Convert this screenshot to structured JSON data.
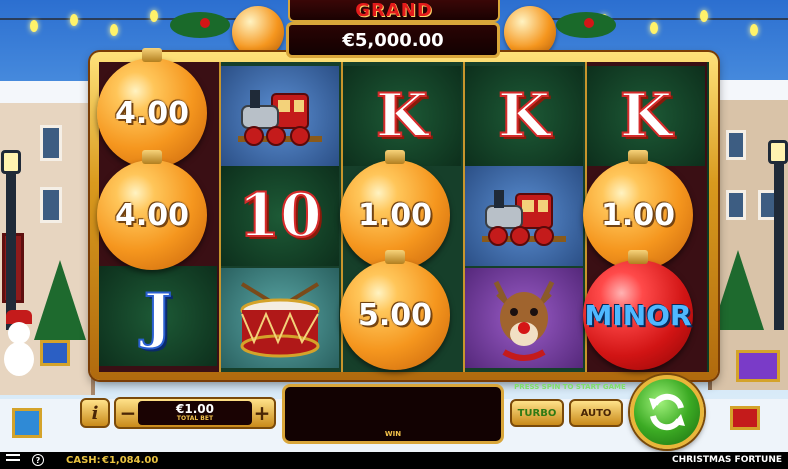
{
  "jackpot": {
    "title": "GRAND",
    "value": "€5,000.00"
  },
  "reels": [
    [
      {
        "type": "ornament",
        "value": "4.00"
      },
      {
        "type": "ornament",
        "value": "4.00"
      },
      {
        "type": "symbol",
        "symbol": "J"
      }
    ],
    [
      {
        "type": "symbol",
        "symbol": "train-icon"
      },
      {
        "type": "symbol",
        "symbol": "10"
      },
      {
        "type": "symbol",
        "symbol": "drum-icon"
      }
    ],
    [
      {
        "type": "symbol",
        "symbol": "K"
      },
      {
        "type": "ornament",
        "value": "1.00"
      },
      {
        "type": "ornament",
        "value": "5.00"
      }
    ],
    [
      {
        "type": "symbol",
        "symbol": "K"
      },
      {
        "type": "symbol",
        "symbol": "train-icon"
      },
      {
        "type": "symbol",
        "symbol": "reindeer-icon"
      }
    ],
    [
      {
        "type": "symbol",
        "symbol": "K"
      },
      {
        "type": "ornament",
        "value": "1.00"
      },
      {
        "type": "ornament",
        "value": "MINOR"
      }
    ]
  ],
  "symbols": {
    "J": "J",
    "ten": "10",
    "K": "K"
  },
  "ornament_values": {
    "r1c1": "4.00",
    "r2c1": "4.00",
    "r2c3": "1.00",
    "r3c3": "5.00",
    "r2c5": "1.00",
    "r3c5": "MINOR"
  },
  "controls": {
    "info_label": "i",
    "bet_minus": "−",
    "bet_plus": "+",
    "bet_value": "€1.00",
    "bet_label": "TOTAL BET",
    "win_label": "WIN",
    "press_message": "PRESS SPIN TO START GAME",
    "turbo_label": "TURBO",
    "auto_label": "AUTO"
  },
  "statusbar": {
    "help_label": "?",
    "cash_label": "CASH:",
    "cash_value": "€1,084.00",
    "game_title": "CHRISTMAS FORTUNE"
  },
  "colors": {
    "frame_gold": "#d99a1e",
    "jackpot_red": "#e31b1b",
    "turbo_green": "#2f7a14",
    "cash_gold": "#e9c340",
    "minor_blue": "#4fb8ff"
  }
}
